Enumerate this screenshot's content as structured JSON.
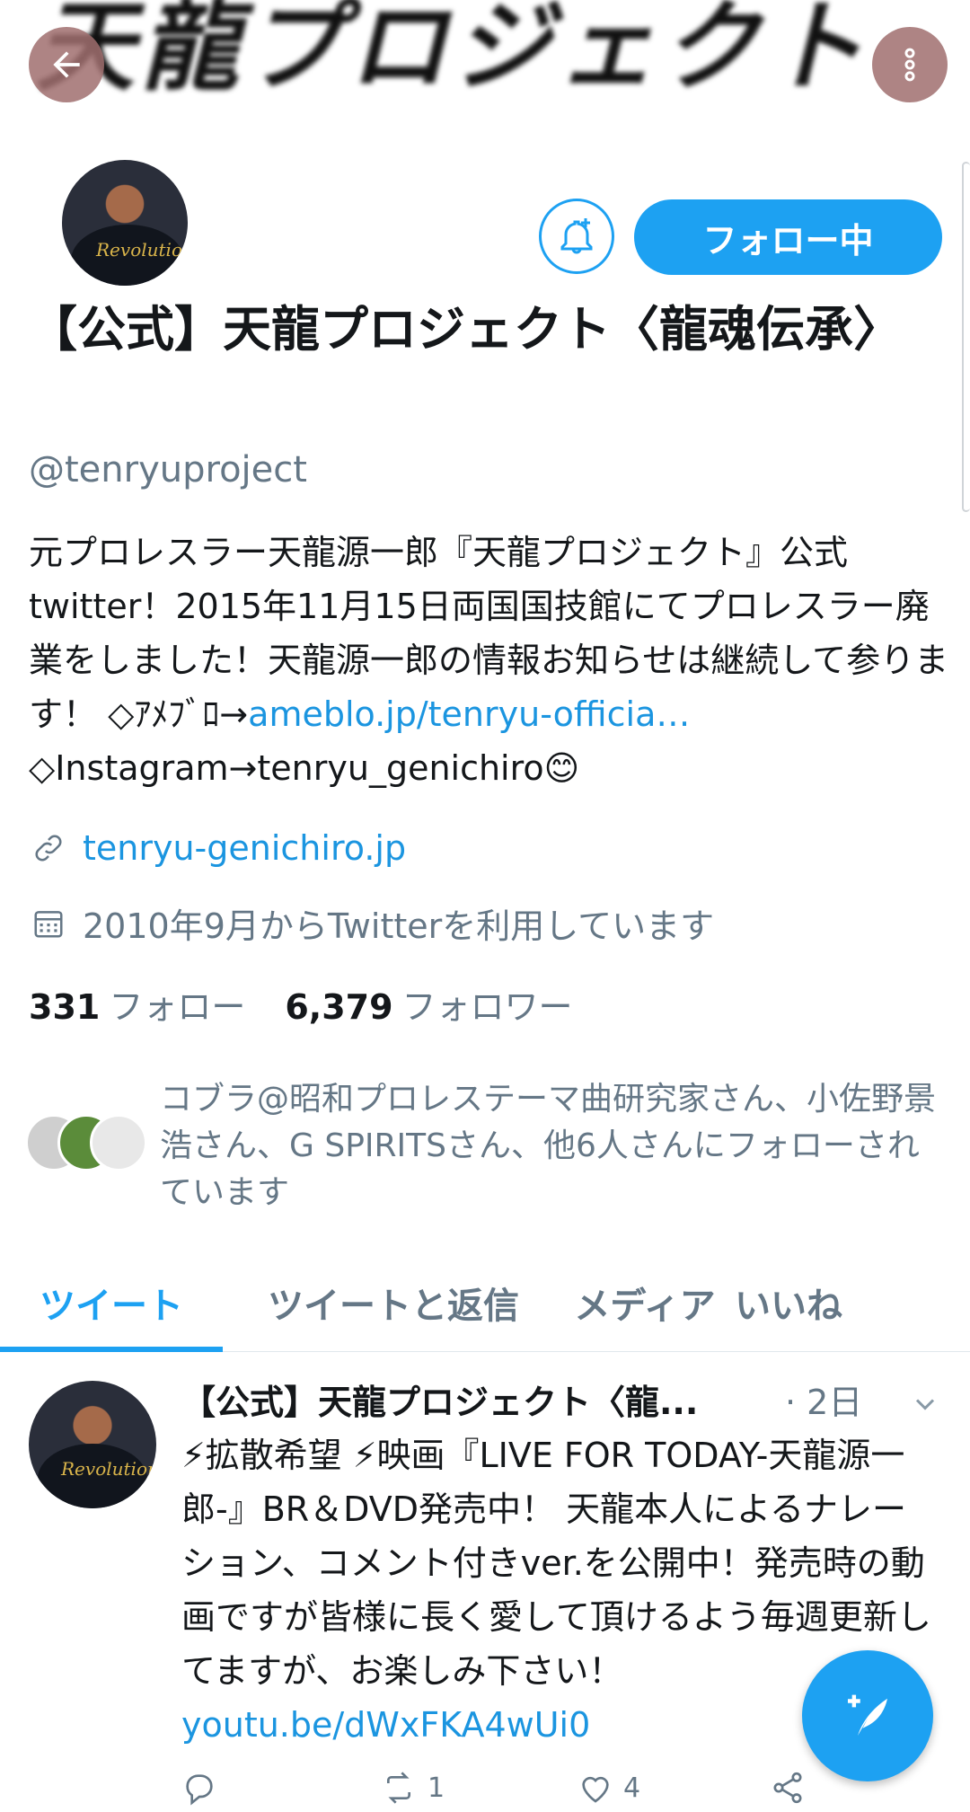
{
  "banner": {
    "text": "天龍プロジェクト"
  },
  "profile": {
    "display_name": "【公式】天龍プロジェクト〈龍魂伝承〉",
    "handle": "@tenryuproject",
    "bio_text": "元プロレスラー天龍源一郎『天龍プロジェクト』公式twitter！2015年11月15日両国国技館にてプロレスラー廃業をしました！天龍源一郎の情報お知らせは継続して参ります！ ◇ｱﾒﾌﾞﾛ→",
    "bio_link": "ameblo.jp/tenryu-officia…",
    "bio_tail": "◇Instagram→tenryu_genichiro😊",
    "website": "tenryu-genichiro.jp",
    "joined": "2010年9月からTwitterを利用しています",
    "following_count": "331",
    "following_label": "フォロー",
    "followers_count": "6,379",
    "followers_label": "フォロワー",
    "followed_by": "コブラ@昭和プロレステーマ曲研究家さん、小佐野景浩さん、G SPIRITSさん、他6人さんにフォローされています",
    "follow_button": "フォロー中",
    "avatar_logo": "Revolution"
  },
  "tabs": [
    {
      "label": "ツイート",
      "active": true
    },
    {
      "label": "ツイートと返信",
      "active": false
    },
    {
      "label": "メディア",
      "active": false
    },
    {
      "label": "いいね",
      "active": false
    }
  ],
  "tweet": {
    "author": "【公式】天龍プロジェクト〈龍...",
    "time": "· 2日",
    "body_text": "⚡拡散希望 ⚡映画『LIVE FOR TODAY-天龍源一郎-』BR＆DVD発売中！ 天龍本人によるナレーション、コメント付きver.を公開中！発売時の動画ですが皆様に長く愛して頂けるよう毎週更新してますが、お楽しみ下さい！",
    "link": "youtu.be/dWxFKA4wUi0",
    "retweets": "1",
    "likes": "4"
  },
  "colors": {
    "accent": "#1da1f2",
    "link": "#1b95e0",
    "muted": "#657786"
  },
  "icons": [
    "back-arrow-icon",
    "more-vertical-icon",
    "bell-plus-icon",
    "link-icon",
    "calendar-icon",
    "chevron-down-icon",
    "reply-icon",
    "retweet-icon",
    "heart-icon",
    "share-icon",
    "compose-icon"
  ]
}
